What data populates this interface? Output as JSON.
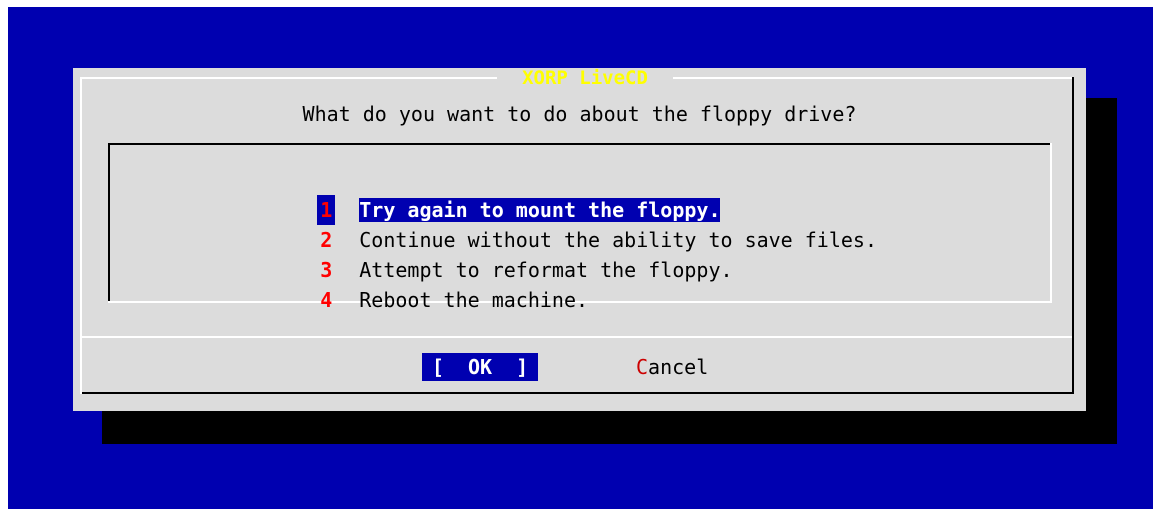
{
  "dialog": {
    "title": "XORP LiveCD",
    "prompt": "What do you want to do about the floppy drive?"
  },
  "menu": {
    "items": [
      {
        "key": "1",
        "label": "Try again to mount the floppy.",
        "selected": true
      },
      {
        "key": "2",
        "label": "Continue without the ability to save files.",
        "selected": false
      },
      {
        "key": "3",
        "label": "Attempt to reformat the floppy.",
        "selected": false
      },
      {
        "key": "4",
        "label": "Reboot the machine.",
        "selected": false
      }
    ]
  },
  "buttons": {
    "ok": {
      "open": "[  ",
      "hotkey": "OK",
      "close": "  ]"
    },
    "cancel": {
      "hotkey": "C",
      "rest": "ancel"
    }
  },
  "colors": {
    "background": "#0000b0",
    "dialog": "#dcdcdc",
    "title": "#ffff00",
    "hotkey": "#ff0000",
    "selection": "#0000b0"
  }
}
